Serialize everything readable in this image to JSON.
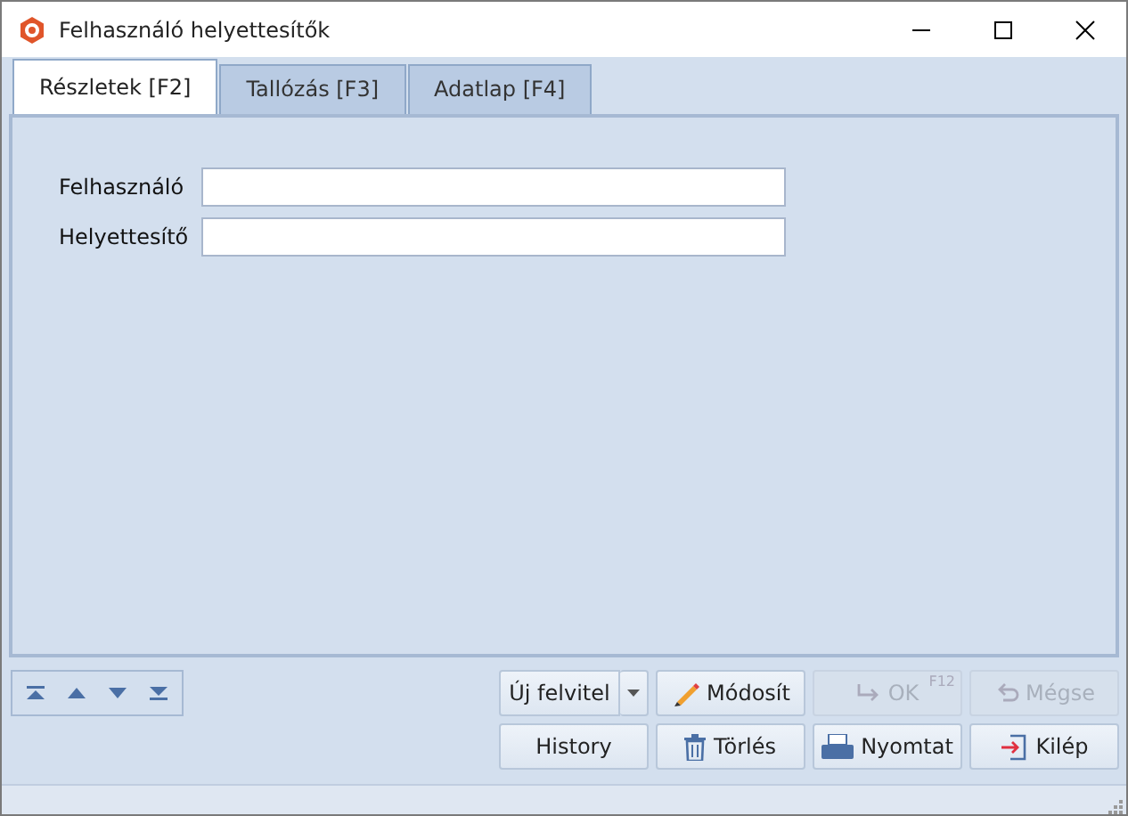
{
  "window": {
    "title": "Felhasználó helyettesítők"
  },
  "tabs": [
    {
      "label": "Részletek [F2]",
      "selected": true
    },
    {
      "label": "Tallózás [F3]",
      "selected": false
    },
    {
      "label": "Adatlap [F4]",
      "selected": false
    }
  ],
  "form": [
    {
      "label": "Felhasználó"
    },
    {
      "label": "Helyettesítő"
    }
  ],
  "buttons": [
    {
      "label": "Új felvitel",
      "kind": "split",
      "disabled": false
    },
    {
      "label": "Módosít",
      "kind": "edit",
      "disabled": false
    },
    {
      "label": "OK",
      "kind": "confirm",
      "shortcut": "F12",
      "disabled": true
    },
    {
      "label": "Mégse",
      "kind": "cancel",
      "disabled": true
    },
    {
      "label": "History",
      "kind": "plain",
      "disabled": false
    },
    {
      "label": "Törlés",
      "kind": "delete",
      "disabled": false
    },
    {
      "label": "Nyomtat",
      "kind": "print",
      "disabled": false
    },
    {
      "label": "Kilép",
      "kind": "exit",
      "disabled": false
    }
  ]
}
